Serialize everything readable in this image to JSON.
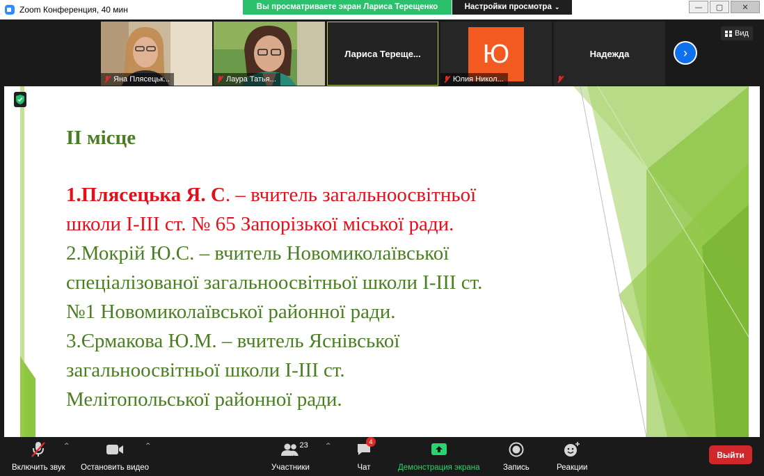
{
  "window": {
    "title": "Zoom Конференция, 40 мин",
    "controls": [
      "—",
      "▢",
      "✕"
    ]
  },
  "share_banner": "Вы просматриваете экран Лариса Терещенко",
  "view_options": {
    "label": "Настройки просмотра",
    "chevron": "⌄"
  },
  "view_button": {
    "label": "Вид",
    "icon": "grid-icon"
  },
  "participants": [
    {
      "name": "Яна Плясецьк...",
      "video": true,
      "muted": true
    },
    {
      "name": "Лаура Татья...",
      "video": true,
      "muted": true
    },
    {
      "name": "Лариса  Терещe...",
      "video": false,
      "muted": false,
      "active_speaker": true
    },
    {
      "name": "Юлия Никол...",
      "video": false,
      "avatar_letter": "Ю",
      "avatar_color": "#f25a22",
      "muted": true
    },
    {
      "name": "Надежда",
      "video": false,
      "muted": true
    }
  ],
  "next_page_arrow": "›",
  "slide": {
    "title": "ІІ місце",
    "lines": [
      {
        "bold": "1.Плясецька Я. С",
        "text": ". – вчитель загальноосвітньої",
        "color": "red"
      },
      {
        "text": "школи І-ІІІ ст. № 65 Запорізької міської ради.",
        "color": "red"
      },
      {
        "text": "2.Мокрій Ю.С. – вчитель Новомиколаївської",
        "color": "green"
      },
      {
        "text": "спеціалізованої загальноосвітньої школи І-ІІІ ст.",
        "color": "green"
      },
      {
        "text": "№1 Новомиколаївської районної ради.",
        "color": "green"
      },
      {
        "text": "3.Єрмакова Ю.М. – вчитель Яснівської",
        "color": "green"
      },
      {
        "text": "загальноосвітньої школи І-ІІІ ст.",
        "color": "green"
      },
      {
        "text": "Мелітопольської районної ради.",
        "color": "green"
      }
    ],
    "colors": {
      "red": "#e3101c",
      "green": "#4b7d24",
      "accent_light": "#8dc63f",
      "accent_dark": "#5a9a1e"
    }
  },
  "toolbar": {
    "unmute": "Включить звук",
    "stop_video": "Остановить видео",
    "participants": "Участники",
    "participants_count": "23",
    "chat": "Чат",
    "chat_badge": "4",
    "share_screen": "Демонстрация экрана",
    "record": "Запись",
    "reactions": "Реакции",
    "leave": "Выйти"
  }
}
